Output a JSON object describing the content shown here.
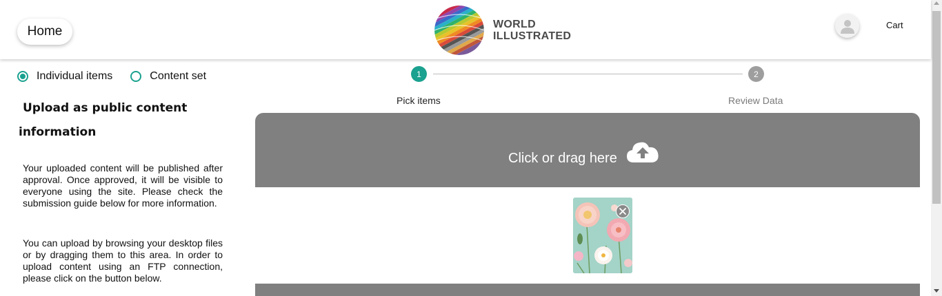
{
  "header": {
    "home_label": "Home",
    "logo": {
      "line1": "WORLD",
      "line2": "ILLUSTRATED"
    },
    "cart_label": "Cart"
  },
  "upload_mode": {
    "options": [
      {
        "label": "Individual items",
        "selected": true
      },
      {
        "label": "Content set",
        "selected": false
      }
    ]
  },
  "left_panel": {
    "title_line1": "Upload as public content",
    "title_line2": "information",
    "paragraph1": "Your uploaded content will be published after approval. Once approved, it will be visible to everyone using the site. Please check the submission guide below for more information.",
    "paragraph2": "You can upload by browsing your desktop files or by dragging them to this area. In order to upload content using an FTP connection, please click on the button below."
  },
  "stepper": {
    "steps": [
      {
        "number": "1",
        "label": "Pick items",
        "active": true
      },
      {
        "number": "2",
        "label": "Review Data",
        "active": false
      }
    ]
  },
  "dropzone": {
    "text": "Click or drag here",
    "icon": "cloud-upload-icon"
  },
  "preview": {
    "items": [
      {
        "thumbnail": "pink and white paper flowers on teal background",
        "remove_icon": "close-icon"
      }
    ]
  },
  "colors": {
    "accent": "#1aa18f",
    "inactive_step": "#9e9e9e",
    "dropzone_bg": "#808080"
  }
}
